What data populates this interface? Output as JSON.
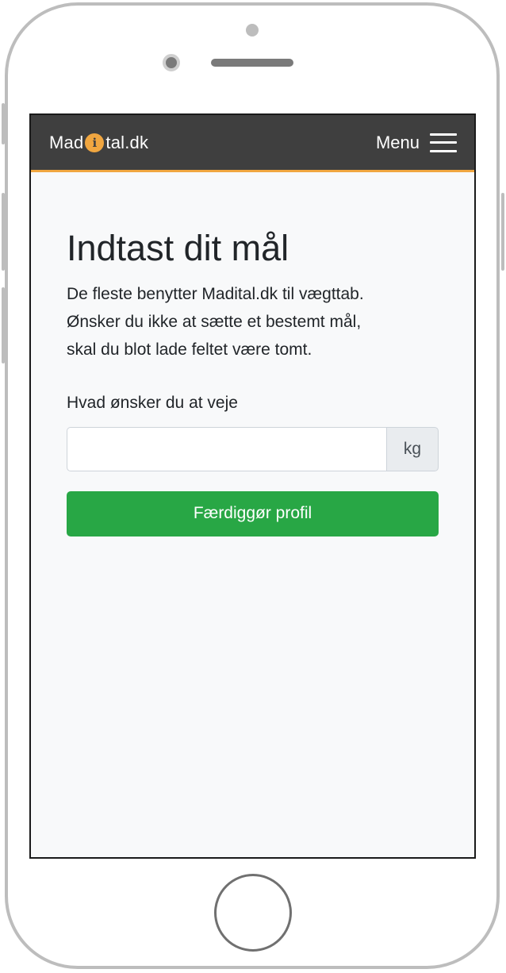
{
  "navbar": {
    "brand_prefix": "Mad",
    "brand_icon": "i",
    "brand_suffix": "tal.dk",
    "menu_label": "Menu"
  },
  "main": {
    "title": "Indtast dit mål",
    "intro_line1": "De fleste benytter Madital.dk til vægttab.",
    "intro_line2": "Ønsker du ikke at sætte et bestemt mål,",
    "intro_line3": "skal du blot lade feltet være tomt.",
    "goal_label": "Hvad ønsker du at veje",
    "goal_value": "",
    "goal_unit": "kg",
    "submit_label": "Færdiggør profil"
  },
  "colors": {
    "navbar_bg": "#3f3f3f",
    "accent": "#f0a640",
    "submit_bg": "#28a745",
    "page_bg": "#f8f9fa"
  },
  "icons": [
    "info-icon",
    "hamburger-icon"
  ]
}
